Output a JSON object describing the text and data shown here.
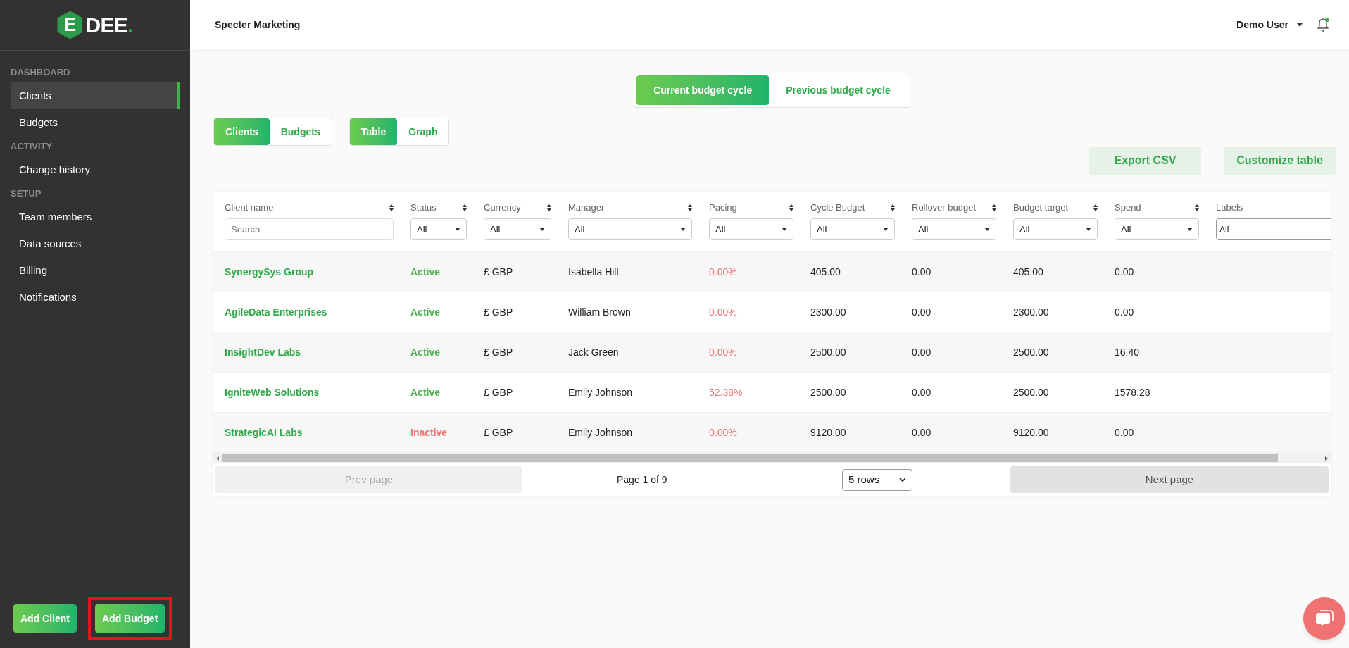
{
  "logo": {
    "mark": "E",
    "text": "DEE",
    "dot": "."
  },
  "sidebar": {
    "sections": [
      {
        "heading": "DASHBOARD",
        "items": [
          {
            "label": "Clients",
            "selected": true
          },
          {
            "label": "Budgets",
            "selected": false
          }
        ]
      },
      {
        "heading": "ACTIVITY",
        "items": [
          {
            "label": "Change history",
            "selected": false
          }
        ]
      },
      {
        "heading": "SETUP",
        "items": [
          {
            "label": "Team members",
            "selected": false
          },
          {
            "label": "Data sources",
            "selected": false
          },
          {
            "label": "Billing",
            "selected": false
          },
          {
            "label": "Notifications",
            "selected": false
          }
        ]
      }
    ],
    "buttons": [
      {
        "label": "Add Client",
        "highlighted": false
      },
      {
        "label": "Add Budget",
        "highlighted": true
      }
    ]
  },
  "header": {
    "title": "Specter Marketing",
    "user": "Demo User",
    "notification_dot": true
  },
  "cycle_tabs": [
    {
      "label": "Current budget cycle",
      "selected": true
    },
    {
      "label": "Previous budget cycle",
      "selected": false
    }
  ],
  "view_tabs": [
    {
      "label": "Clients",
      "selected": true
    },
    {
      "label": "Budgets",
      "selected": false
    }
  ],
  "mode_tabs": [
    {
      "label": "Table",
      "selected": true
    },
    {
      "label": "Graph",
      "selected": false
    }
  ],
  "actions": [
    "Export CSV",
    "Customize table"
  ],
  "table": {
    "columns": [
      {
        "label": "Client name",
        "kind": "search",
        "placeholder": "Search"
      },
      {
        "label": "Status",
        "kind": "select",
        "value": "All"
      },
      {
        "label": "Currency",
        "kind": "select",
        "value": "All"
      },
      {
        "label": "Manager",
        "kind": "select",
        "value": "All"
      },
      {
        "label": "Pacing",
        "kind": "select",
        "value": "All"
      },
      {
        "label": "Cycle Budget",
        "kind": "select",
        "value": "All"
      },
      {
        "label": "Rollover budget",
        "kind": "select",
        "value": "All"
      },
      {
        "label": "Budget target",
        "kind": "select",
        "value": "All"
      },
      {
        "label": "Spend",
        "kind": "select",
        "value": "All"
      },
      {
        "label": "Labels",
        "kind": "text",
        "value": "All"
      }
    ],
    "rows": [
      {
        "client": "SynergySys Group",
        "status": "Active",
        "active": true,
        "currency": "£ GBP",
        "manager": "Isabella Hill",
        "pacing": "0.00%",
        "cycle_budget": "405.00",
        "rollover": "0.00",
        "target": "405.00",
        "spend": "0.00"
      },
      {
        "client": "AgileData Enterprises",
        "status": "Active",
        "active": true,
        "currency": "£ GBP",
        "manager": "William Brown",
        "pacing": "0.00%",
        "cycle_budget": "2300.00",
        "rollover": "0.00",
        "target": "2300.00",
        "spend": "0.00"
      },
      {
        "client": "InsightDev Labs",
        "status": "Active",
        "active": true,
        "currency": "£ GBP",
        "manager": "Jack Green",
        "pacing": "0.00%",
        "cycle_budget": "2500.00",
        "rollover": "0.00",
        "target": "2500.00",
        "spend": "16.40"
      },
      {
        "client": "IgniteWeb Solutions",
        "status": "Active",
        "active": true,
        "currency": "£ GBP",
        "manager": "Emily Johnson",
        "pacing": "52.38%",
        "cycle_budget": "2500.00",
        "rollover": "0.00",
        "target": "2500.00",
        "spend": "1578.28"
      },
      {
        "client": "StrategicAI Labs",
        "status": "Inactive",
        "active": false,
        "currency": "£ GBP",
        "manager": "Emily Johnson",
        "pacing": "0.00%",
        "cycle_budget": "9120.00",
        "rollover": "0.00",
        "target": "9120.00",
        "spend": "0.00"
      }
    ]
  },
  "pagination": {
    "prev": "Prev page",
    "prev_disabled": true,
    "page": "Page 1 of 9",
    "rows": "5 rows",
    "next": "Next page",
    "next_disabled": false
  }
}
